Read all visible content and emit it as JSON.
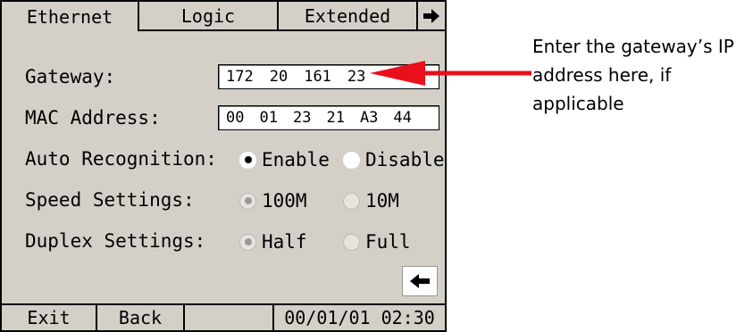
{
  "tabs": {
    "ethernet": "Ethernet",
    "logic": "Logic",
    "extended": "Extended",
    "next_icon": "right-arrow-icon"
  },
  "form": {
    "gateway_label": "Gateway:",
    "gateway_octets": [
      "172",
      "20",
      "161",
      "23"
    ],
    "mac_label": "MAC Address:",
    "mac_bytes": [
      "00",
      "01",
      "23",
      "21",
      "A3",
      "44"
    ],
    "auto_label": "Auto Recognition:",
    "auto_options": [
      "Enable",
      "Disable"
    ],
    "speed_label": "Speed Settings:",
    "speed_options": [
      "100M",
      "10M"
    ],
    "duplex_label": "Duplex Settings:",
    "duplex_options": [
      "Half",
      "Full"
    ]
  },
  "status_bar": {
    "exit": "Exit",
    "back": "Back",
    "datetime": "00/01/01 02:30"
  },
  "annotation": {
    "text": "Enter the gateway’s IP address here, if applicable",
    "arrow_color": "#e8101a"
  }
}
